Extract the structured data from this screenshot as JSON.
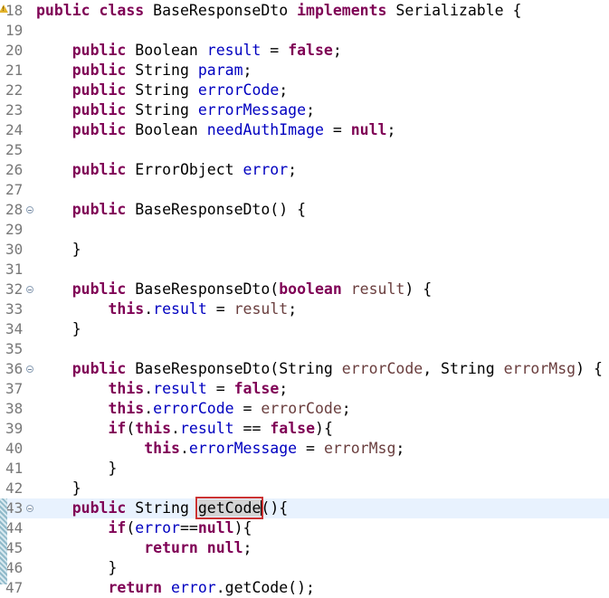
{
  "editor": {
    "language": "java",
    "current_line": "43",
    "lines": [
      {
        "num": "18",
        "warning": true,
        "fold": false,
        "tokens": [
          [
            "kw",
            "public"
          ],
          [
            "txt",
            " "
          ],
          [
            "kw",
            "class"
          ],
          [
            "txt",
            " BaseResponseDto "
          ],
          [
            "kw",
            "implements"
          ],
          [
            "txt",
            " Serializable {"
          ]
        ]
      },
      {
        "num": "19",
        "tokens": []
      },
      {
        "num": "20",
        "tokens": [
          [
            "txt",
            "    "
          ],
          [
            "kw",
            "public"
          ],
          [
            "txt",
            " Boolean "
          ],
          [
            "fld",
            "result"
          ],
          [
            "txt",
            " = "
          ],
          [
            "kw",
            "false"
          ],
          [
            "txt",
            ";"
          ]
        ]
      },
      {
        "num": "21",
        "tokens": [
          [
            "txt",
            "    "
          ],
          [
            "kw",
            "public"
          ],
          [
            "txt",
            " String "
          ],
          [
            "fld",
            "param"
          ],
          [
            "txt",
            ";"
          ]
        ]
      },
      {
        "num": "22",
        "tokens": [
          [
            "txt",
            "    "
          ],
          [
            "kw",
            "public"
          ],
          [
            "txt",
            " String "
          ],
          [
            "fld",
            "errorCode"
          ],
          [
            "txt",
            ";"
          ]
        ]
      },
      {
        "num": "23",
        "tokens": [
          [
            "txt",
            "    "
          ],
          [
            "kw",
            "public"
          ],
          [
            "txt",
            " String "
          ],
          [
            "fld",
            "errorMessage"
          ],
          [
            "txt",
            ";"
          ]
        ]
      },
      {
        "num": "24",
        "tokens": [
          [
            "txt",
            "    "
          ],
          [
            "kw",
            "public"
          ],
          [
            "txt",
            " Boolean "
          ],
          [
            "fld",
            "needAuthImage"
          ],
          [
            "txt",
            " = "
          ],
          [
            "kw",
            "null"
          ],
          [
            "txt",
            ";"
          ]
        ]
      },
      {
        "num": "25",
        "tokens": []
      },
      {
        "num": "26",
        "tokens": [
          [
            "txt",
            "    "
          ],
          [
            "kw",
            "public"
          ],
          [
            "txt",
            " ErrorObject "
          ],
          [
            "fld",
            "error"
          ],
          [
            "txt",
            ";"
          ]
        ]
      },
      {
        "num": "27",
        "tokens": []
      },
      {
        "num": "28",
        "fold": true,
        "tokens": [
          [
            "txt",
            "    "
          ],
          [
            "kw",
            "public"
          ],
          [
            "txt",
            " BaseResponseDto() {"
          ]
        ]
      },
      {
        "num": "29",
        "tokens": []
      },
      {
        "num": "30",
        "tokens": [
          [
            "txt",
            "    }"
          ]
        ]
      },
      {
        "num": "31",
        "tokens": []
      },
      {
        "num": "32",
        "fold": true,
        "tokens": [
          [
            "txt",
            "    "
          ],
          [
            "kw",
            "public"
          ],
          [
            "txt",
            " BaseResponseDto("
          ],
          [
            "kw",
            "boolean"
          ],
          [
            "txt",
            " "
          ],
          [
            "var",
            "result"
          ],
          [
            "txt",
            ") {"
          ]
        ]
      },
      {
        "num": "33",
        "tokens": [
          [
            "txt",
            "        "
          ],
          [
            "kw",
            "this"
          ],
          [
            "txt",
            "."
          ],
          [
            "fld",
            "result"
          ],
          [
            "txt",
            " = "
          ],
          [
            "var",
            "result"
          ],
          [
            "txt",
            ";"
          ]
        ]
      },
      {
        "num": "34",
        "tokens": [
          [
            "txt",
            "    }"
          ]
        ]
      },
      {
        "num": "35",
        "tokens": []
      },
      {
        "num": "36",
        "fold": true,
        "tokens": [
          [
            "txt",
            "    "
          ],
          [
            "kw",
            "public"
          ],
          [
            "txt",
            " BaseResponseDto(String "
          ],
          [
            "var",
            "errorCode"
          ],
          [
            "txt",
            ", String "
          ],
          [
            "var",
            "errorMsg"
          ],
          [
            "txt",
            ") {"
          ]
        ]
      },
      {
        "num": "37",
        "tokens": [
          [
            "txt",
            "        "
          ],
          [
            "kw",
            "this"
          ],
          [
            "txt",
            "."
          ],
          [
            "fld",
            "result"
          ],
          [
            "txt",
            " = "
          ],
          [
            "kw",
            "false"
          ],
          [
            "txt",
            ";"
          ]
        ]
      },
      {
        "num": "38",
        "tokens": [
          [
            "txt",
            "        "
          ],
          [
            "kw",
            "this"
          ],
          [
            "txt",
            "."
          ],
          [
            "fld",
            "errorCode"
          ],
          [
            "txt",
            " = "
          ],
          [
            "var",
            "errorCode"
          ],
          [
            "txt",
            ";"
          ]
        ]
      },
      {
        "num": "39",
        "tokens": [
          [
            "txt",
            "        "
          ],
          [
            "kw",
            "if"
          ],
          [
            "txt",
            "("
          ],
          [
            "kw",
            "this"
          ],
          [
            "txt",
            "."
          ],
          [
            "fld",
            "result"
          ],
          [
            "txt",
            " == "
          ],
          [
            "kw",
            "false"
          ],
          [
            "txt",
            "){"
          ]
        ]
      },
      {
        "num": "40",
        "tokens": [
          [
            "txt",
            "            "
          ],
          [
            "kw",
            "this"
          ],
          [
            "txt",
            "."
          ],
          [
            "fld",
            "errorMessage"
          ],
          [
            "txt",
            " = "
          ],
          [
            "var",
            "errorMsg"
          ],
          [
            "txt",
            ";"
          ]
        ]
      },
      {
        "num": "41",
        "tokens": [
          [
            "txt",
            "        }"
          ]
        ]
      },
      {
        "num": "42",
        "tokens": [
          [
            "txt",
            "    }"
          ]
        ]
      },
      {
        "num": "43",
        "fold": true,
        "current": true,
        "tokens": [
          [
            "txt",
            "    "
          ],
          [
            "kw",
            "public"
          ],
          [
            "txt",
            " String "
          ],
          [
            "box",
            "getCode"
          ],
          [
            "txt",
            "(){"
          ]
        ]
      },
      {
        "num": "44",
        "tokens": [
          [
            "txt",
            "        "
          ],
          [
            "kw",
            "if"
          ],
          [
            "txt",
            "("
          ],
          [
            "fld",
            "error"
          ],
          [
            "txt",
            "=="
          ],
          [
            "kw",
            "null"
          ],
          [
            "txt",
            "){"
          ]
        ]
      },
      {
        "num": "45",
        "tokens": [
          [
            "txt",
            "            "
          ],
          [
            "kw",
            "return"
          ],
          [
            "txt",
            " "
          ],
          [
            "kw",
            "null"
          ],
          [
            "txt",
            ";"
          ]
        ]
      },
      {
        "num": "46",
        "tokens": [
          [
            "txt",
            "        }"
          ]
        ]
      },
      {
        "num": "47",
        "tokens": [
          [
            "txt",
            "        "
          ],
          [
            "kw",
            "return"
          ],
          [
            "txt",
            " "
          ],
          [
            "fld",
            "error"
          ],
          [
            "txt",
            ".getCode();"
          ]
        ]
      }
    ]
  }
}
